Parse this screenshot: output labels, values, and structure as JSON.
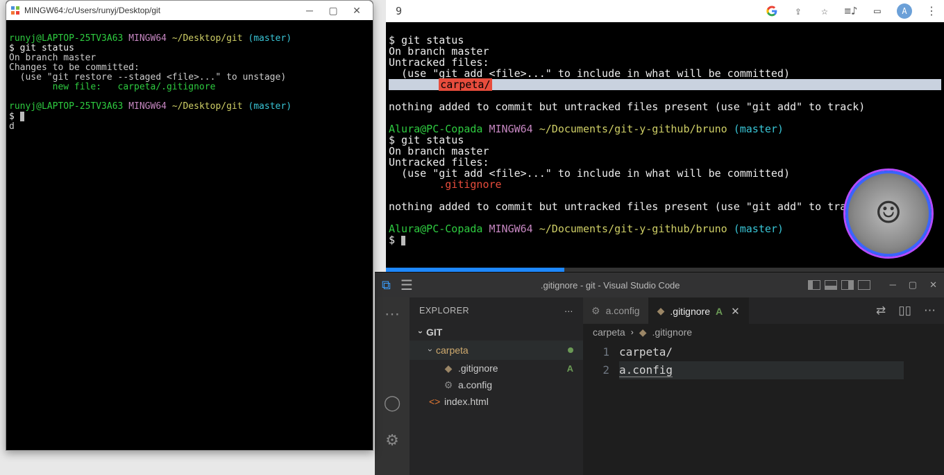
{
  "leftTerminal": {
    "title": "MINGW64:/c/Users/runyj/Desktop/git",
    "prompt": {
      "user": "runyj@LAPTOP-25TV3A63",
      "env": "MINGW64",
      "path": "~/Desktop/git",
      "branch": "(master)"
    },
    "lines": {
      "cmd1": "$ git status",
      "l1": "On branch master",
      "l2": "Changes to be committed:",
      "l3": "  (use \"git restore --staged <file>...\" to unstage)",
      "newFile": "        new file:   carpeta/.gitignore",
      "promptSymbol": "$ ",
      "d": "d"
    }
  },
  "rightTerminal": {
    "browserExtLeft": "9",
    "avatarLetter": "A",
    "block1": {
      "p1": "$ git status",
      "p2": "On branch master",
      "p3": "Untracked files:",
      "p4": "  (use \"git add <file>...\" to include in what will be committed)",
      "hl": "carpeta/",
      "p5": "nothing added to commit but untracked files present (use \"git add\" to track)"
    },
    "prompt": {
      "user": "Alura@PC-Copada",
      "env": "MINGW64",
      "path": "~/Documents/git-y-github/bruno",
      "branch": "(master)"
    },
    "block2": {
      "p1": "$ git status",
      "p2": "On branch master",
      "p3": "Untracked files:",
      "p4": "  (use \"git add <file>...\" to include in what will be committed)",
      "red": "        .gitignore",
      "p5": "nothing added to commit but untracked files present (use \"git add\" to track)"
    },
    "promptSymbol": "$ "
  },
  "vscode": {
    "title": ".gitignore - git - Visual Studio Code",
    "explorerLabel": "EXPLORER",
    "tree": {
      "root": "GIT",
      "folder": "carpeta",
      "file1": ".gitignore",
      "file1Badge": "A",
      "file2": "a.config",
      "file3": "index.html"
    },
    "tabs": {
      "t1": "a.config",
      "t2": ".gitignore",
      "t2suffix": "A"
    },
    "crumbs": {
      "c1": "carpeta",
      "c2": ".gitignore"
    },
    "editor": {
      "ln1": "1",
      "ln2": "2",
      "line1": "carpeta/",
      "line2": "a.config"
    }
  }
}
